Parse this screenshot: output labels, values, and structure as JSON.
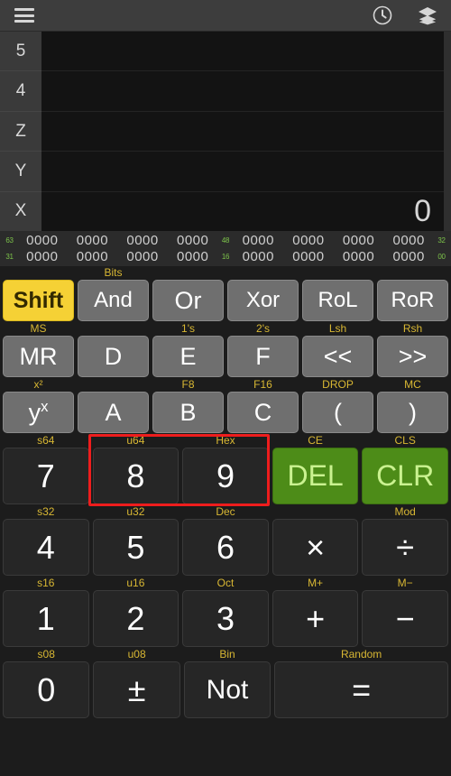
{
  "appbar": {
    "menu_icon": "hamburger-menu-icon",
    "history_icon": "clock-history-icon",
    "layers_icon": "layers-stack-icon"
  },
  "display": {
    "registers": [
      {
        "name": "5",
        "value": ""
      },
      {
        "name": "4",
        "value": ""
      },
      {
        "name": "Z",
        "value": ""
      },
      {
        "name": "Y",
        "value": ""
      },
      {
        "name": "X",
        "value": "0"
      }
    ]
  },
  "bitgrid": {
    "rows": [
      {
        "left_mark": "63",
        "mid_mark": "48",
        "right_mark": "32",
        "left_nibbles": [
          "0000",
          "0000",
          "0000",
          "0000"
        ],
        "right_nibbles": [
          "0000",
          "0000",
          "0000",
          "0000"
        ]
      },
      {
        "left_mark": "31",
        "mid_mark": "16",
        "right_mark": "00",
        "left_nibbles": [
          "0000",
          "0000",
          "0000",
          "0000"
        ],
        "right_nibbles": [
          "0000",
          "0000",
          "0000",
          "0000"
        ]
      }
    ]
  },
  "colors": {
    "shift_active": "#f5d135",
    "clear_green": "#4d8c18",
    "shift_label": "#d8b733",
    "bit_mark": "#7cc24a",
    "highlight": "#ee1d1d"
  },
  "keypad": {
    "rows": [
      {
        "keys": [
          {
            "label": "Shift",
            "shift_label": "",
            "style": "shift"
          },
          {
            "label": "And",
            "shift_label": "Bits",
            "style": "fn"
          },
          {
            "label": "Or",
            "shift_label": "",
            "style": "fn"
          },
          {
            "label": "Xor",
            "shift_label": "",
            "style": "fn"
          },
          {
            "label": "RoL",
            "shift_label": "",
            "style": "fn"
          },
          {
            "label": "RoR",
            "shift_label": "",
            "style": "fn"
          }
        ]
      },
      {
        "keys": [
          {
            "label": "MR",
            "shift_label": "MS",
            "style": "fn"
          },
          {
            "label": "D",
            "shift_label": "",
            "style": "fn"
          },
          {
            "label": "E",
            "shift_label": "1's",
            "style": "fn"
          },
          {
            "label": "F",
            "shift_label": "2's",
            "style": "fn"
          },
          {
            "label": "<<",
            "shift_label": "Lsh",
            "style": "fn"
          },
          {
            "label": ">>",
            "shift_label": "Rsh",
            "style": "fn"
          }
        ]
      },
      {
        "keys": [
          {
            "label": "yx",
            "shift_label": "x²",
            "style": "fn"
          },
          {
            "label": "A",
            "shift_label": "",
            "style": "fn"
          },
          {
            "label": "B",
            "shift_label": "F8",
            "style": "fn"
          },
          {
            "label": "C",
            "shift_label": "F16",
            "style": "fn"
          },
          {
            "label": "(",
            "shift_label": "DROP",
            "style": "fn"
          },
          {
            "label": ")",
            "shift_label": "MC",
            "style": "fn"
          }
        ]
      },
      {
        "keys": [
          {
            "label": "7",
            "shift_label": "s64",
            "style": "num"
          },
          {
            "label": "8",
            "shift_label": "u64",
            "style": "num"
          },
          {
            "label": "9",
            "shift_label": "Hex",
            "style": "num"
          },
          {
            "label": "DEL",
            "shift_label": "CE",
            "style": "green"
          },
          {
            "label": "CLR",
            "shift_label": "CLS",
            "style": "green"
          }
        ]
      },
      {
        "keys": [
          {
            "label": "4",
            "shift_label": "s32",
            "style": "num"
          },
          {
            "label": "5",
            "shift_label": "u32",
            "style": "num"
          },
          {
            "label": "6",
            "shift_label": "Dec",
            "style": "num"
          },
          {
            "label": "×",
            "shift_label": "",
            "style": "num"
          },
          {
            "label": "÷",
            "shift_label": "Mod",
            "style": "num"
          }
        ]
      },
      {
        "keys": [
          {
            "label": "1",
            "shift_label": "s16",
            "style": "num"
          },
          {
            "label": "2",
            "shift_label": "u16",
            "style": "num"
          },
          {
            "label": "3",
            "shift_label": "Oct",
            "style": "num"
          },
          {
            "label": "+",
            "shift_label": "M+",
            "style": "num"
          },
          {
            "label": "−",
            "shift_label": "M−",
            "style": "num"
          }
        ]
      },
      {
        "keys": [
          {
            "label": "0",
            "shift_label": "s08",
            "style": "num"
          },
          {
            "label": "±",
            "shift_label": "u08",
            "style": "num"
          },
          {
            "label": "Not",
            "shift_label": "Bin",
            "style": "num"
          },
          {
            "label": "=",
            "shift_label": "Random",
            "style": "num",
            "span": 2
          }
        ]
      }
    ]
  }
}
